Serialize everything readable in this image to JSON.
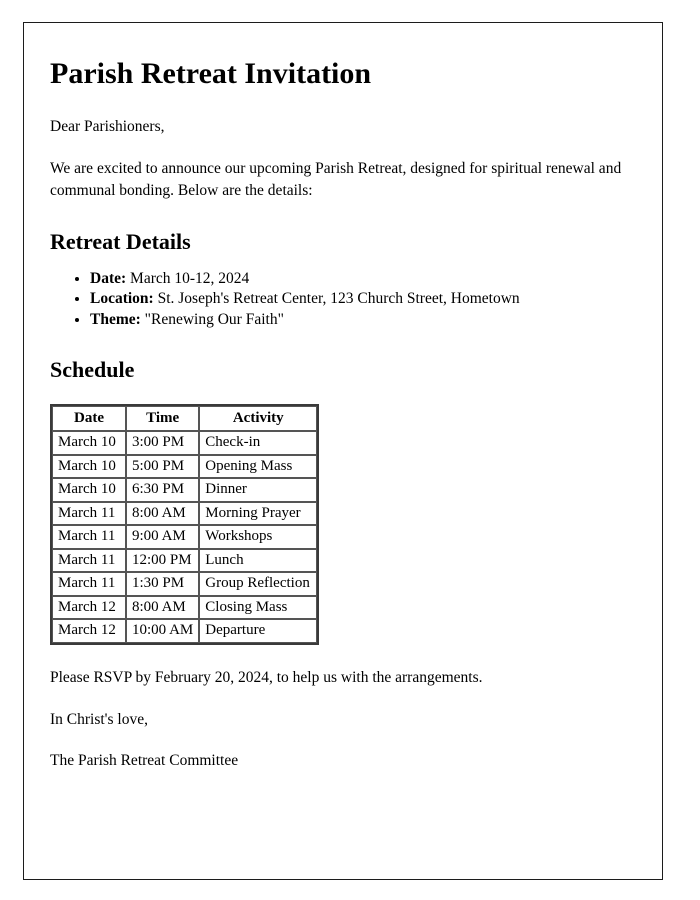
{
  "document": {
    "title": "Parish Retreat Invitation",
    "salutation": "Dear Parishioners,",
    "intro": "We are excited to announce our upcoming Parish Retreat, designed for spiritual renewal and communal bonding. Below are the details:",
    "details_heading": "Retreat Details",
    "details": [
      {
        "label": "Date:",
        "value": " March 10-12, 2024"
      },
      {
        "label": "Location:",
        "value": " St. Joseph's Retreat Center, 123 Church Street, Hometown"
      },
      {
        "label": "Theme:",
        "value": " \"Renewing Our Faith\""
      }
    ],
    "schedule_heading": "Schedule",
    "schedule": {
      "columns": [
        "Date",
        "Time",
        "Activity"
      ],
      "rows": [
        [
          "March 10",
          "3:00 PM",
          "Check-in"
        ],
        [
          "March 10",
          "5:00 PM",
          "Opening Mass"
        ],
        [
          "March 10",
          "6:30 PM",
          "Dinner"
        ],
        [
          "March 11",
          "8:00 AM",
          "Morning Prayer"
        ],
        [
          "March 11",
          "9:00 AM",
          "Workshops"
        ],
        [
          "March 11",
          "12:00 PM",
          "Lunch"
        ],
        [
          "March 11",
          "1:30 PM",
          "Group Reflection"
        ],
        [
          "March 12",
          "8:00 AM",
          "Closing Mass"
        ],
        [
          "March 12",
          "10:00 AM",
          "Departure"
        ]
      ]
    },
    "rsvp": "Please RSVP by February 20, 2024, to help us with the arrangements.",
    "signoff": "In Christ's love,",
    "signature": "The Parish Retreat Committee"
  }
}
